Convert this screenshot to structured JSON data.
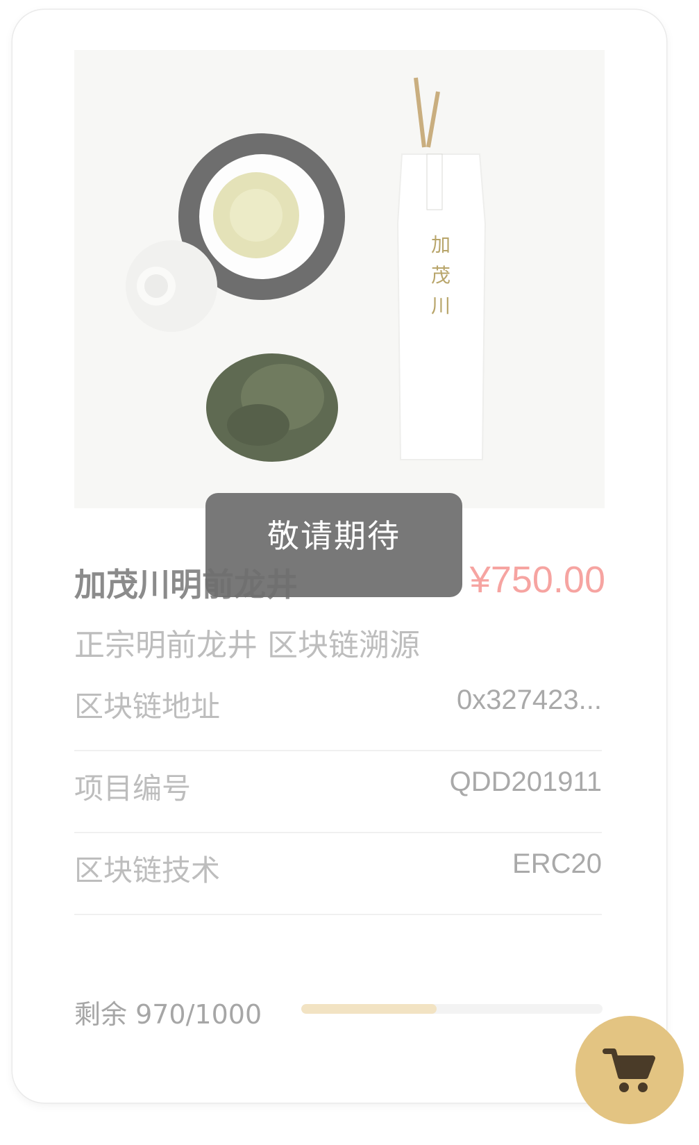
{
  "product": {
    "image_alt": "加茂川",
    "package_text": "加茂川",
    "title": "加茂川明前龙井",
    "price": "¥750.00",
    "subtitle": "正宗明前龙井 区块链溯源"
  },
  "overlay": {
    "message": "敬请期待"
  },
  "info": [
    {
      "label": "区块链地址",
      "value": "0x327423..."
    },
    {
      "label": "项目编号",
      "value": "QDD201911"
    },
    {
      "label": "区块链技术",
      "value": "ERC20"
    }
  ],
  "stock": {
    "label": "剩余 970/1000",
    "remaining": 970,
    "total": 1000,
    "progress_fraction": 0.45
  },
  "colors": {
    "price": "#f6a4a1",
    "progress_fill": "#f2e3c3",
    "cart_button": "#e3c482",
    "cart_icon": "#4a3b28"
  },
  "icons": {
    "cart": "shopping-cart-icon"
  }
}
